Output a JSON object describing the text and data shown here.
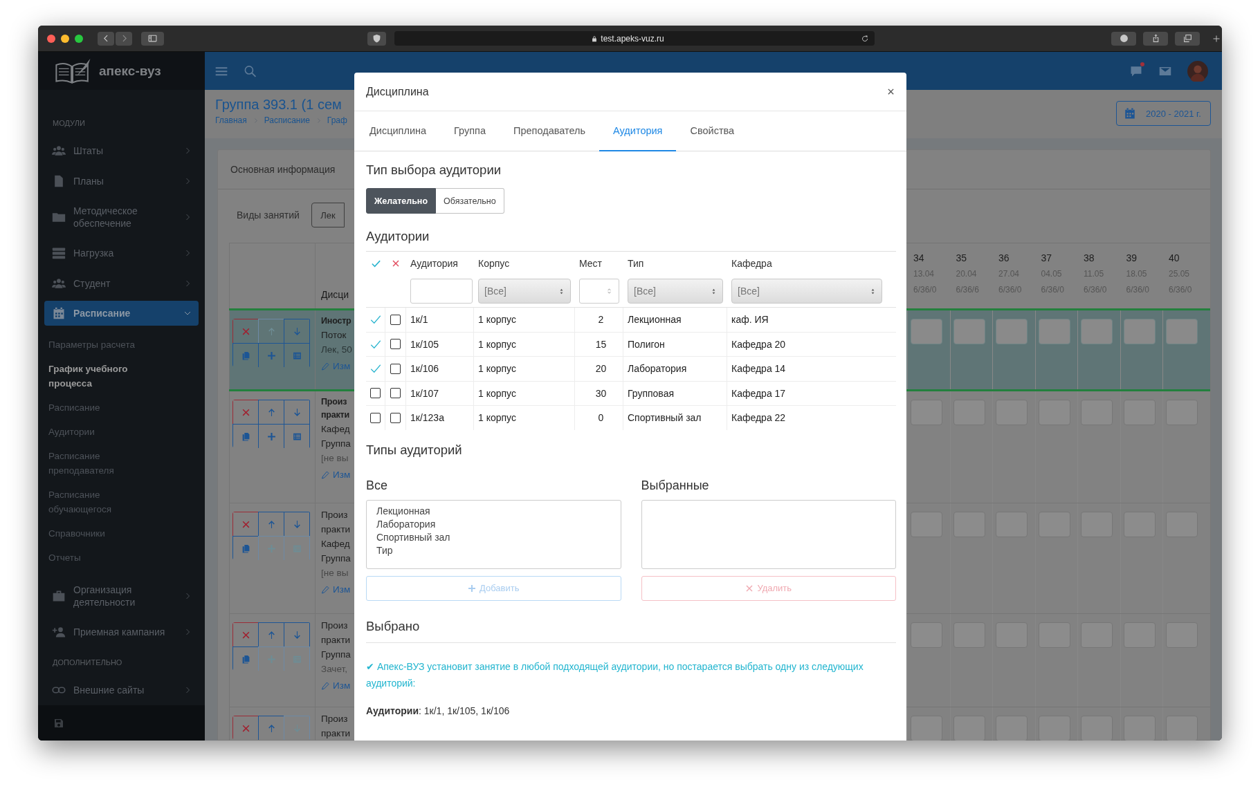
{
  "browser": {
    "url": "test.apeks-vuz.ru"
  },
  "sidebar": {
    "logo": "апекс-вуз",
    "groups": [
      {
        "heading": "МОДУЛИ",
        "items": [
          {
            "label": "Штаты",
            "selected": false,
            "expanded": false
          },
          {
            "label": "Планы",
            "selected": false,
            "expanded": false
          },
          {
            "label": "Методическое обеспечение",
            "selected": false,
            "expanded": false
          },
          {
            "label": "Нагрузка",
            "selected": false,
            "expanded": false
          },
          {
            "label": "Студент",
            "selected": false,
            "expanded": false
          },
          {
            "label": "Расписание",
            "selected": true,
            "expanded": true,
            "children": [
              {
                "label": "Параметры расчета",
                "selected": false
              },
              {
                "label": "График учебного процесса",
                "selected": true
              },
              {
                "label": "Расписание",
                "selected": false
              },
              {
                "label": "Аудитории",
                "selected": false
              },
              {
                "label": "Расписание преподавателя",
                "selected": false
              },
              {
                "label": "Расписание обучающегося",
                "selected": false
              },
              {
                "label": "Справочники",
                "selected": false
              },
              {
                "label": "Отчеты",
                "selected": false
              }
            ]
          },
          {
            "label": "Организация деятельности",
            "selected": false,
            "expanded": false
          },
          {
            "label": "Приемная кампания",
            "selected": false,
            "expanded": false
          }
        ]
      },
      {
        "heading": "ДОПОЛНИТЕЛЬНО",
        "items": [
          {
            "label": "Внешние сайты",
            "selected": false,
            "expanded": false
          }
        ]
      }
    ]
  },
  "header": {
    "messages_unread": true
  },
  "page": {
    "title": "Группа 393.1 (1 сем",
    "breadcrumbs": [
      "Главная",
      "Расписание",
      "Граф"
    ],
    "year_button": "2020 - 2021 г.",
    "card_tab": "Основная информация",
    "filter_label": "Виды занятий",
    "filter_buttons": [
      "Лек"
    ]
  },
  "schedule": {
    "column_heading": "Дисци",
    "weeks": [
      {
        "number": "34",
        "date": "13.04",
        "load": "6/36/0"
      },
      {
        "number": "35",
        "date": "20.04",
        "load": "6/36/6"
      },
      {
        "number": "36",
        "date": "27.04",
        "load": "6/36/0"
      },
      {
        "number": "37",
        "date": "04.05",
        "load": "6/36/0"
      },
      {
        "number": "38",
        "date": "11.05",
        "load": "6/36/0"
      },
      {
        "number": "39",
        "date": "18.05",
        "load": "6/36/0"
      },
      {
        "number": "40",
        "date": "25.05",
        "load": "6/36/0"
      }
    ],
    "rows": [
      {
        "highlighted": true,
        "actions": [
          {
            "kind": "delete",
            "disabled": false
          },
          {
            "kind": "up",
            "disabled": true
          },
          {
            "kind": "down",
            "disabled": false
          },
          {
            "kind": "copy",
            "disabled": false
          },
          {
            "kind": "add",
            "disabled": false
          },
          {
            "kind": "list",
            "disabled": false
          }
        ],
        "lines": [
          {
            "kind": "title",
            "text": "Иностр"
          },
          {
            "kind": "text",
            "text": "Поток"
          },
          {
            "kind": "muted",
            "text": "Лек, 50"
          },
          {
            "kind": "link",
            "text": "Изм"
          }
        ]
      },
      {
        "highlighted": false,
        "actions": [
          {
            "kind": "delete",
            "disabled": false
          },
          {
            "kind": "up",
            "disabled": false
          },
          {
            "kind": "down",
            "disabled": false
          },
          {
            "kind": "copy",
            "disabled": false
          },
          {
            "kind": "add",
            "disabled": false
          },
          {
            "kind": "list",
            "disabled": false
          }
        ],
        "lines": [
          {
            "kind": "title",
            "text": "Произ"
          },
          {
            "kind": "title",
            "text": "практи"
          },
          {
            "kind": "text",
            "text": "Кафед"
          },
          {
            "kind": "text",
            "text": "Группа"
          },
          {
            "kind": "muted",
            "text": "[не вы"
          },
          {
            "kind": "link",
            "text": "Изм"
          }
        ]
      },
      {
        "highlighted": false,
        "actions": [
          {
            "kind": "delete",
            "disabled": false
          },
          {
            "kind": "up",
            "disabled": false
          },
          {
            "kind": "down",
            "disabled": false
          },
          {
            "kind": "copy",
            "disabled": false
          },
          {
            "kind": "add",
            "disabled": true
          },
          {
            "kind": "list",
            "disabled": true
          }
        ],
        "lines": [
          {
            "kind": "text",
            "text": "Произ"
          },
          {
            "kind": "text",
            "text": "практи"
          },
          {
            "kind": "text",
            "text": "Кафед"
          },
          {
            "kind": "text",
            "text": "Группа"
          },
          {
            "kind": "muted",
            "text": "[не вы"
          },
          {
            "kind": "link",
            "text": "Изм"
          }
        ]
      },
      {
        "highlighted": false,
        "actions": [
          {
            "kind": "delete",
            "disabled": false
          },
          {
            "kind": "up",
            "disabled": false
          },
          {
            "kind": "down",
            "disabled": false
          },
          {
            "kind": "copy",
            "disabled": false
          },
          {
            "kind": "add",
            "disabled": true
          },
          {
            "kind": "list",
            "disabled": true
          }
        ],
        "lines": [
          {
            "kind": "text",
            "text": "Произ"
          },
          {
            "kind": "text",
            "text": "практи"
          },
          {
            "kind": "text",
            "text": "Группа"
          },
          {
            "kind": "muted",
            "text": "Зачет,"
          },
          {
            "kind": "link",
            "text": "Изм"
          }
        ]
      },
      {
        "highlighted": false,
        "actions": [
          {
            "kind": "delete",
            "disabled": false
          },
          {
            "kind": "up",
            "disabled": false
          },
          {
            "kind": "down",
            "disabled": true
          }
        ],
        "lines": [
          {
            "kind": "text",
            "text": "Произ"
          },
          {
            "kind": "text",
            "text": "практи"
          }
        ]
      }
    ]
  },
  "modal": {
    "title": "Дисциплина",
    "tabs": [
      {
        "label": "Дисциплина",
        "selected": false
      },
      {
        "label": "Группа",
        "selected": false
      },
      {
        "label": "Преподаватель",
        "selected": false
      },
      {
        "label": "Аудитория",
        "selected": true
      },
      {
        "label": "Свойства",
        "selected": false
      }
    ],
    "room_choice": {
      "heading": "Тип выбора аудитории",
      "options": [
        {
          "label": "Желательно",
          "selected": true
        },
        {
          "label": "Обязательно",
          "selected": false
        }
      ]
    },
    "rooms": {
      "heading": "Аудитории",
      "columns": [
        "Аудитория",
        "Корпус",
        "Мест",
        "Тип",
        "Кафедра"
      ],
      "filters": [
        {
          "kind": "text"
        },
        {
          "kind": "select",
          "value": "[Все]"
        },
        {
          "kind": "number"
        },
        {
          "kind": "select",
          "value": "[Все]"
        },
        {
          "kind": "select",
          "value": "[Все]"
        }
      ],
      "rows": [
        {
          "selected": true,
          "checked": false,
          "cells": [
            "1к/1",
            "1 корпус",
            "2",
            "Лекционная",
            "каф. ИЯ"
          ]
        },
        {
          "selected": true,
          "checked": false,
          "cells": [
            "1к/105",
            "1 корпус",
            "15",
            "Полигон",
            "Кафедра 20"
          ]
        },
        {
          "selected": true,
          "checked": false,
          "cells": [
            "1к/106",
            "1 корпус",
            "20",
            "Лаборатория",
            "Кафедра 14"
          ]
        },
        {
          "selected": false,
          "checked": false,
          "cells": [
            "1к/107",
            "1 корпус",
            "30",
            "Групповая",
            "Кафедра 17"
          ]
        },
        {
          "selected": false,
          "checked": false,
          "cells": [
            "1к/123а",
            "1 корпус",
            "0",
            "Спортивный зал",
            "Кафедра 22"
          ]
        }
      ]
    },
    "room_types": {
      "heading": "Типы аудиторий",
      "all": {
        "label": "Все",
        "options": [
          "Лекционная",
          "Лаборатория",
          "Спортивный зал",
          "Тир"
        ]
      },
      "chosen": {
        "label": "Выбранные"
      },
      "add_button": {
        "label": "Добавить",
        "disabled": true
      },
      "remove_button": {
        "label": "Удалить",
        "disabled": true
      }
    },
    "summary": {
      "heading": "Выбрано",
      "message": "✔ Апекс-ВУЗ установит занятие в любой подходящей аудитории, но постарается выбрать одну из следующих аудиторий:",
      "rooms_line": "**Аудитории**: 1к/1, 1к/105, 1к/106"
    }
  }
}
